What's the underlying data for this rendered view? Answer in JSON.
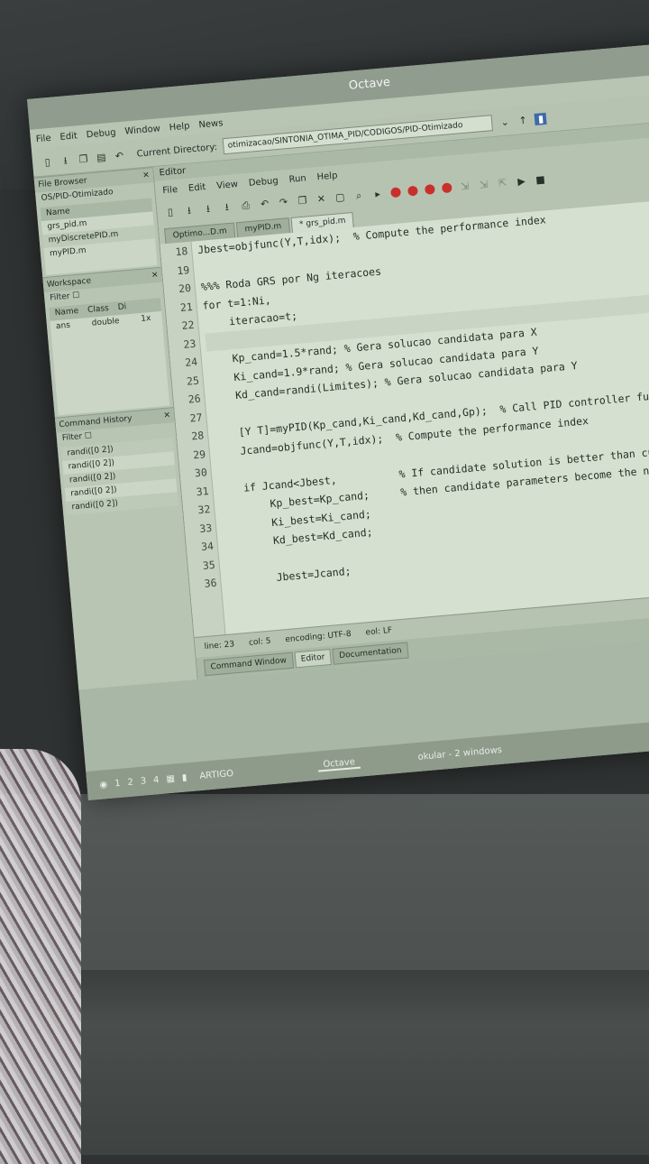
{
  "window": {
    "title": "Octave"
  },
  "menu": [
    "File",
    "Edit",
    "Debug",
    "Window",
    "Help",
    "News"
  ],
  "toolbar": {
    "current_directory_label": "Current Directory:",
    "current_directory_value": "otimizacao/SINTONIA_OTIMA_PID/CODIGOS/PID-Otimizado"
  },
  "file_browser": {
    "title": "File Browser",
    "path": "OS/PID-Otimizado",
    "column": "Name",
    "items": [
      "grs_pid.m",
      "myDiscretePID.m",
      "myPID.m"
    ]
  },
  "workspace": {
    "title": "Workspace",
    "filter_label": "Filter",
    "columns": [
      "Name",
      "Class",
      "Di"
    ],
    "rows": [
      {
        "name": "ans",
        "class": "double",
        "dim": "1x"
      }
    ]
  },
  "command_history": {
    "title": "Command History",
    "filter_label": "Filter",
    "items": [
      "randi([0 2])",
      "randi([0 2])",
      "randi([0 2])",
      "randi([0 2])",
      "randi([0 2])"
    ]
  },
  "editor": {
    "title": "Editor",
    "menu": [
      "File",
      "Edit",
      "View",
      "Debug",
      "Run",
      "Help"
    ],
    "tabs": [
      {
        "label": "Optimo...D.m",
        "active": false
      },
      {
        "label": "myPID.m",
        "active": false
      },
      {
        "label": "* grs_pid.m",
        "active": true
      }
    ],
    "top_partial_line": "Jbest=objfunc(Y,T,idx);  % Compute the performance index",
    "line_numbers": [
      "18",
      "19",
      "20",
      "21",
      "22",
      "23",
      "24",
      "25",
      "26",
      "27",
      "28",
      "29",
      "30",
      "31",
      "32",
      "33",
      "34",
      "35",
      "36"
    ],
    "lines": [
      "Jbest=objfunc(Y,T,idx);  % Compute the performance index",
      "",
      "%%% Roda GRS por Ng iteracoes",
      "for t=1:Ni,",
      "    iteracao=t;",
      "",
      "    Kp_cand=1.5*rand; % Gera solucao candidata para X",
      "    Ki_cand=1.9*rand; % Gera solucao candidata para Y",
      "    Kd_cand=randi(Limites); % Gera solucao candidata para Y",
      "",
      "    [Y T]=myPID(Kp_cand,Ki_cand,Kd_cand,Gp);  % Call PID controller functi",
      "    Jcand=objfunc(Y,T,idx);  % Compute the performance index",
      "",
      "    if Jcand<Jbest,          % If candidate solution is better than current",
      "        Kp_best=Kp_cand;     % then candidate parameters become the new best",
      "        Ki_best=Ki_cand;",
      "        Kd_best=Kd_cand;",
      "",
      "        Jbest=Jcand;"
    ],
    "status": {
      "line": "line: 23",
      "col": "col: 5",
      "encoding": "encoding: UTF-8",
      "eol": "eol: LF"
    }
  },
  "bottom_tabs": [
    "Command Window",
    "Editor",
    "Documentation"
  ],
  "taskbar": {
    "workspaces": [
      "1",
      "2",
      "3",
      "4"
    ],
    "items": [
      "ARTIGO",
      "Octave",
      "okular - 2 windows"
    ]
  },
  "colors": {
    "screen_bg": "#a9b7a6",
    "code_bg": "#d6e0d1",
    "titlebar": "#8f9c8e"
  }
}
